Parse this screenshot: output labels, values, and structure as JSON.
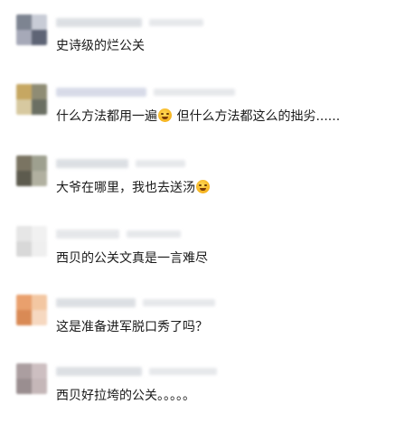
{
  "comments": [
    {
      "text": "史诗级的烂公关",
      "colors": [
        "#7d8491",
        "#c8ccd6",
        "#a6a9b8",
        "#5e6475"
      ]
    },
    {
      "text": "什么方法都用一遍",
      "text2": "但什么方法都这么的拙劣......",
      "emoji": "laughing-icon",
      "colors": [
        "#c6a762",
        "#8f8c74",
        "#d7c9a0",
        "#6b6f63"
      ]
    },
    {
      "text": "大爷在哪里，我也去送汤",
      "emoji": "grinning-sweat-icon",
      "colors": [
        "#7a7462",
        "#9ea08f",
        "#5d5b4e",
        "#b1b0a0"
      ]
    },
    {
      "text": "西贝的公关文真是一言难尽",
      "colors": [
        "#e6e6e6",
        "#f1f1f1",
        "#d8d8d8",
        "#efefef"
      ]
    },
    {
      "text": "这是准备进军脱口秀了吗？",
      "colors": [
        "#e9a06d",
        "#f3c7a2",
        "#d98a55",
        "#f6d8c0"
      ]
    },
    {
      "text": "西贝好拉垮的公关。。。。。",
      "colors": [
        "#ab9ea0",
        "#cdbfc1",
        "#9a8e90",
        "#c5b7b8"
      ]
    }
  ]
}
